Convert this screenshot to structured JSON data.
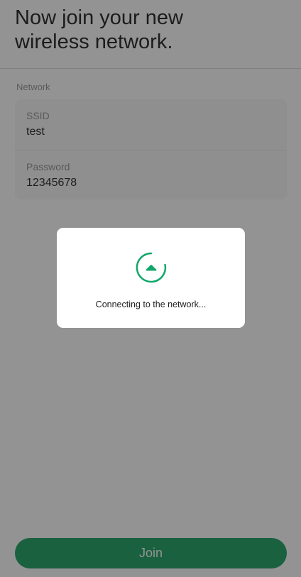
{
  "header": {
    "title_line1": "Now join your new",
    "title_line2": "wireless network."
  },
  "network": {
    "section_label": "Network",
    "ssid_label": "SSID",
    "ssid_value": "test",
    "password_label": "Password",
    "password_value": "12345678"
  },
  "footer": {
    "join_label": "Join"
  },
  "dialog": {
    "message": "Connecting to the network...",
    "spinner_icon": "chevron-up-spinner-icon"
  },
  "colors": {
    "accent": "#0b9a57",
    "spinner": "#11a86a",
    "overlay": "rgba(40,40,40,0.5)"
  }
}
